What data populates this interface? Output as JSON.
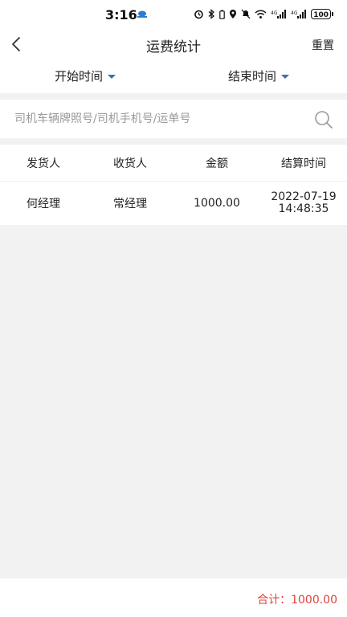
{
  "status_bar": {
    "time": "3:16",
    "battery": "100",
    "icons": [
      "alarm-icon",
      "bluetooth-icon",
      "location-icon",
      "mute-icon",
      "wifi-icon",
      "signal-4g-icon",
      "signal-4g-icon",
      "battery-icon"
    ]
  },
  "header": {
    "title": "运费统计",
    "reset_label": "重置"
  },
  "filters": {
    "start_label": "开始时间",
    "end_label": "结束时间"
  },
  "search": {
    "placeholder": "司机车辆牌照号/司机手机号/运单号",
    "value": ""
  },
  "table": {
    "columns": [
      "发货人",
      "收货人",
      "金额",
      "结算时间"
    ],
    "rows": [
      {
        "shipper": "何经理",
        "receiver": "常经理",
        "amount": "1000.00",
        "settle_date": "2022-07-19",
        "settle_time": "14:48:35"
      }
    ]
  },
  "footer": {
    "total_label": "合计：",
    "total_value": "1000.00"
  },
  "colors": {
    "accent": "#3a6fb0",
    "total_red": "#e0433a",
    "background": "#f2f2f2"
  }
}
